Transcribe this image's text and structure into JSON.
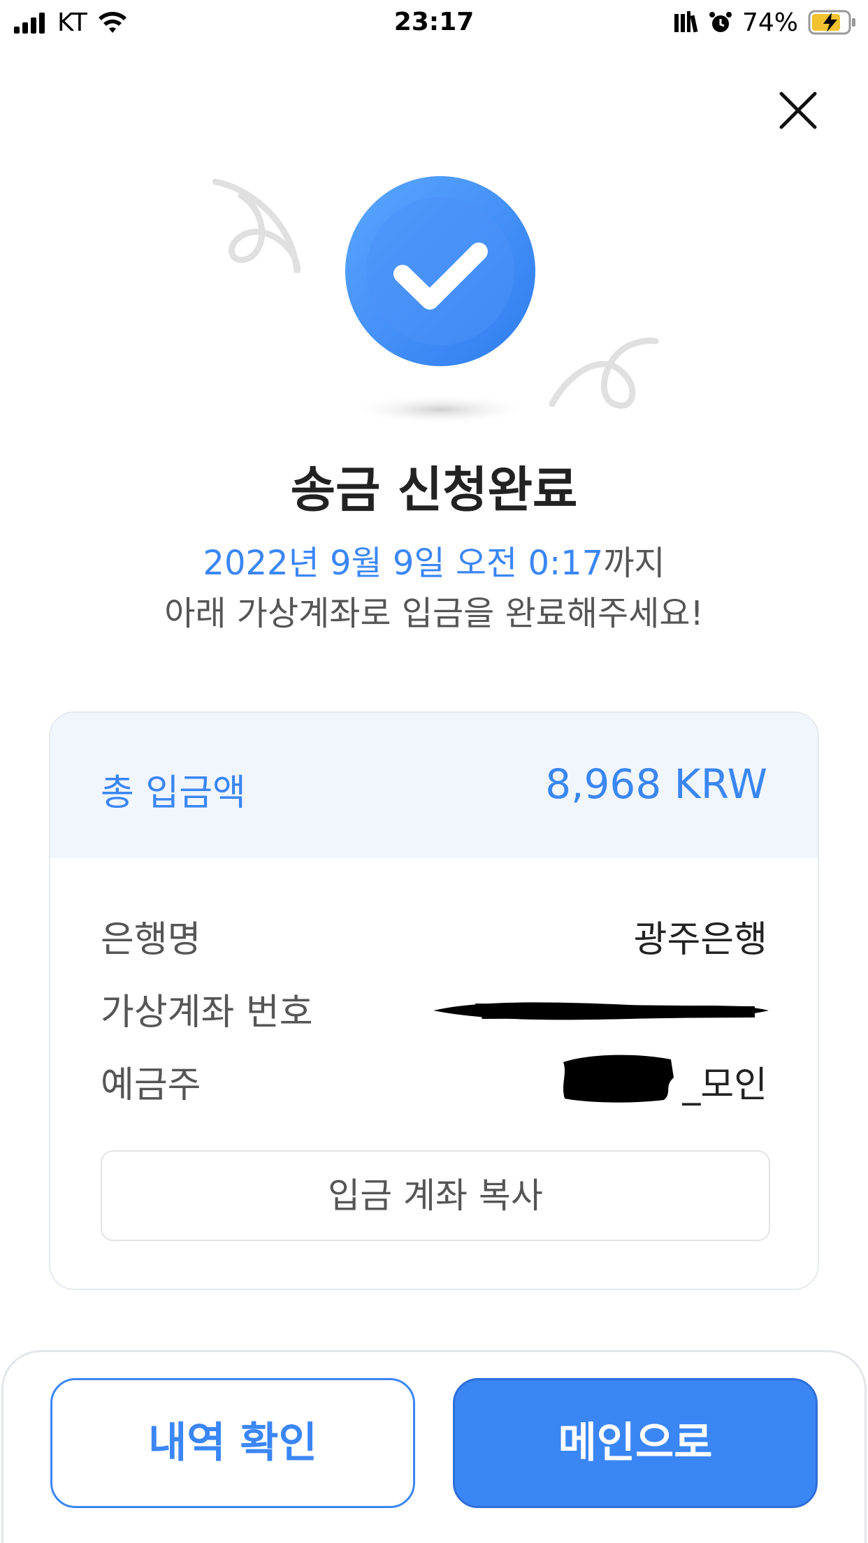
{
  "status_bar": {
    "carrier": "KT",
    "time": "23:17",
    "battery": "74%"
  },
  "result": {
    "title": "송금 신청완료",
    "deadline": "2022년 9월 9일 오전 0:17",
    "deadline_suffix": "까지",
    "instruction": "아래 가상계좌로 입금을 완료해주세요!"
  },
  "deposit": {
    "total_label": "총 입금액",
    "total_value": "8,968 KRW",
    "rows": [
      {
        "label": "은행명",
        "value": "광주은행"
      },
      {
        "label": "가상계좌 번호",
        "value": ""
      },
      {
        "label": "예금주",
        "value": "_모인"
      }
    ],
    "copy_button": "입금 계좌 복사"
  },
  "actions": {
    "history": "내역 확인",
    "main": "메인으로"
  },
  "colors": {
    "accent": "#3a86f5",
    "header_bg": "#f1f6fd"
  }
}
